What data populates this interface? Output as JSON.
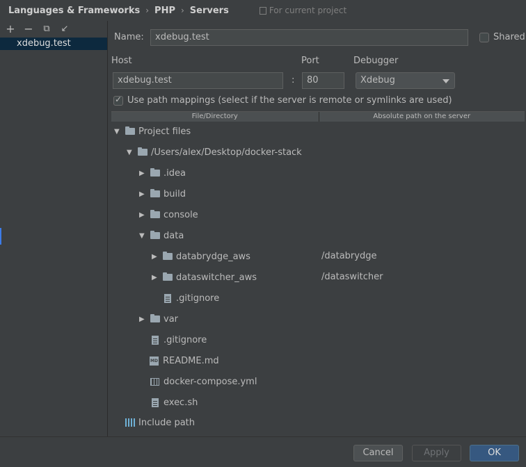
{
  "breadcrumb": {
    "items": [
      "Languages & Frameworks",
      "PHP",
      "Servers"
    ],
    "separator": "›",
    "scope": "For current project"
  },
  "left_panel": {
    "toolbar_icons": [
      "plus-icon",
      "minus-icon",
      "copy-icon",
      "import-icon"
    ],
    "toolbar_glyphs": {
      "plus": "+",
      "minus": "−",
      "copy": "⧉",
      "import": "↙"
    },
    "servers": [
      "xdebug.test"
    ]
  },
  "form": {
    "name_label": "Name:",
    "name_value": "xdebug.test",
    "shared_label": "Shared",
    "host_label": "Host",
    "host_value": "xdebug.test",
    "port_label": "Port",
    "port_sep": ":",
    "port_value": "80",
    "debugger_label": "Debugger",
    "debugger_value": "Xdebug",
    "path_mappings_label": "Use path mappings (select if the server is remote or symlinks are used)"
  },
  "mapping_table": {
    "columns": [
      "File/Directory",
      "Absolute path on the server"
    ],
    "rows": [
      {
        "label": "Project files",
        "expanded": true,
        "icon": "folder",
        "server_path": ""
      },
      {
        "label": "/Users/alex/Desktop/docker-stack",
        "expanded": true,
        "icon": "folder",
        "server_path": ""
      },
      {
        "label": ".idea",
        "expanded": false,
        "icon": "folder",
        "server_path": ""
      },
      {
        "label": "build",
        "expanded": false,
        "icon": "folder",
        "server_path": ""
      },
      {
        "label": "console",
        "expanded": false,
        "icon": "folder",
        "server_path": ""
      },
      {
        "label": "data",
        "expanded": true,
        "icon": "folder",
        "server_path": ""
      },
      {
        "label": "databrydge_aws",
        "expanded": false,
        "icon": "folder",
        "server_path": "/databrydge"
      },
      {
        "label": "dataswitcher_aws",
        "expanded": false,
        "icon": "folder",
        "server_path": "/dataswitcher"
      },
      {
        "label": ".gitignore",
        "icon": "file",
        "server_path": ""
      },
      {
        "label": "var",
        "expanded": false,
        "icon": "folder",
        "server_path": ""
      },
      {
        "label": ".gitignore",
        "icon": "file",
        "server_path": ""
      },
      {
        "label": "README.md",
        "icon": "markdown",
        "server_path": ""
      },
      {
        "label": "docker-compose.yml",
        "icon": "yaml",
        "server_path": ""
      },
      {
        "label": "exec.sh",
        "icon": "file",
        "server_path": ""
      },
      {
        "label": "Include path",
        "icon": "library",
        "server_path": ""
      }
    ]
  },
  "buttons": {
    "cancel": "Cancel",
    "apply": "Apply",
    "ok": "OK"
  },
  "colors": {
    "background": "#3c3f41",
    "selection": "#0d293e",
    "primary_button": "#365880"
  }
}
